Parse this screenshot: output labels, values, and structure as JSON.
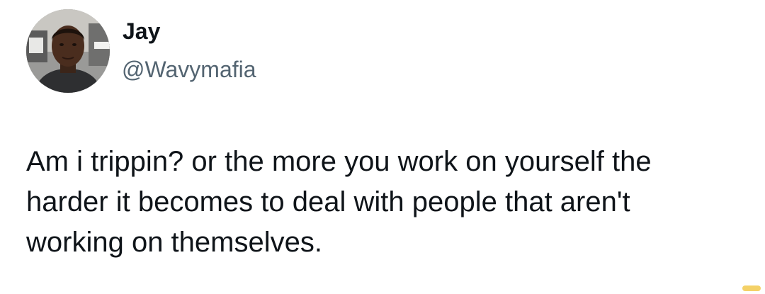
{
  "author": {
    "display_name": "Jay",
    "handle": "@Wavymafia"
  },
  "tweet": {
    "text": "Am i trippin? or the more you work on yourself the\nharder it becomes to deal with people that aren't\nworking on themselves."
  },
  "colors": {
    "text": "#0f1419",
    "handle": "#536471",
    "background": "#ffffff"
  }
}
